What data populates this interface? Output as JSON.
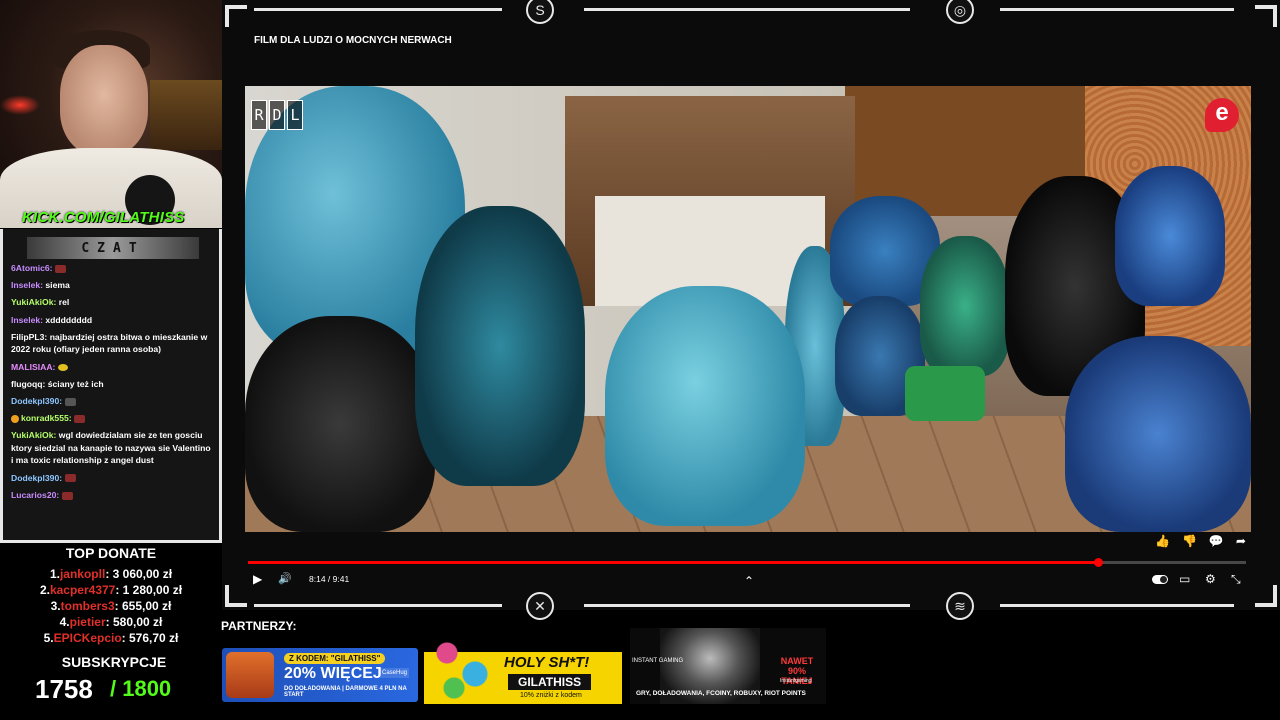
{
  "stream": {
    "kick_url": "KICK.COM/GILATHISS"
  },
  "chat": {
    "title": "CZAT",
    "messages": [
      {
        "user": "6Atomic6:",
        "user_color": "#c68cff",
        "text": ""
      },
      {
        "user": "Inselek:",
        "user_color": "#c68cff",
        "text": "siema"
      },
      {
        "user": "YukiAkiOk:",
        "user_color": "#b6ff6a",
        "text": "rel"
      },
      {
        "user": "Inselek:",
        "user_color": "#c68cff",
        "text": "xdddddddd"
      },
      {
        "user": "FilipPL3:",
        "user_color": "#ffffff",
        "text": "najbardziej ostra bitwa o mieszkanie w 2022 roku (ofiary jeden ranna osoba)"
      },
      {
        "user": "MALISIAA:",
        "user_color": "#e68cff",
        "text": ""
      },
      {
        "user": "flugoqq:",
        "user_color": "#ffffff",
        "text": "ściany też ich"
      },
      {
        "user": "Dodekpl390:",
        "user_color": "#8cc6ff",
        "text": ""
      },
      {
        "user": "konradk555:",
        "user_color": "#b6ff6a",
        "text": ""
      },
      {
        "user": "YukiAkiOk:",
        "user_color": "#b6ff6a",
        "text": "wgl dowiedzialam sie ze ten gosciu ktory siedzial na kanapie to nazywa sie Valentino i ma toxic relationship z angel dust"
      },
      {
        "user": "Dodekpl390:",
        "user_color": "#8cc6ff",
        "text": ""
      },
      {
        "user": "Lucarios20:",
        "user_color": "#c68cff",
        "text": ""
      }
    ]
  },
  "donations": {
    "title": "TOP DONATE",
    "items": [
      {
        "rank": "1.",
        "name": "jankopll",
        "amount": ": 3 060,00 zł"
      },
      {
        "rank": "2.",
        "name": "kacper4377",
        "amount": ": 1 280,00 zł"
      },
      {
        "rank": "3.",
        "name": "tombers3",
        "amount": ": 655,00 zł"
      },
      {
        "rank": "4.",
        "name": "pietier",
        "amount": ": 580,00 zł"
      },
      {
        "rank": "5.",
        "name": "EPICKepcio",
        "amount": ": 576,70 zł"
      }
    ]
  },
  "subs": {
    "title": "SUBSKRYPCJE",
    "count": "1758",
    "goal": "/ 1800"
  },
  "player": {
    "title": "FILM DLA LUDZI O MOCNYCH NERWACH",
    "watermark_letters": [
      "R",
      "D",
      "L"
    ],
    "channel_logo": "e",
    "time": "8:14 / 9:41",
    "progress": 0.852,
    "icons": {
      "like": "👍",
      "dislike": "👎",
      "comment": "💬",
      "share": "➦",
      "play": "▶",
      "volume": "🔊",
      "chevron": "⌃",
      "cc": "▭",
      "settings": "⚙",
      "fullscreen": "⤡"
    }
  },
  "partners": {
    "title": "PARTNERZY:",
    "p1": {
      "pill": "Z KODEM: \"GILATHISS\"",
      "big": "20% WIĘCEJ",
      "small": "DO DOŁADOWANIA | DARMOWE 4 PLN NA START",
      "brand": "CaseHug"
    },
    "p2": {
      "headline": "HOLY SH*T!",
      "code": "GILATHISS",
      "disc": "10% zniżki z kodem"
    },
    "p3": {
      "brand": "INSTANT GAMING",
      "promo": "NAWET 90% TANIEJ",
      "site": "Instantgaming",
      "foot": "GRY, DOŁADOWANIA, FCOINY, ROBUXY, RIOT POINTS"
    }
  }
}
